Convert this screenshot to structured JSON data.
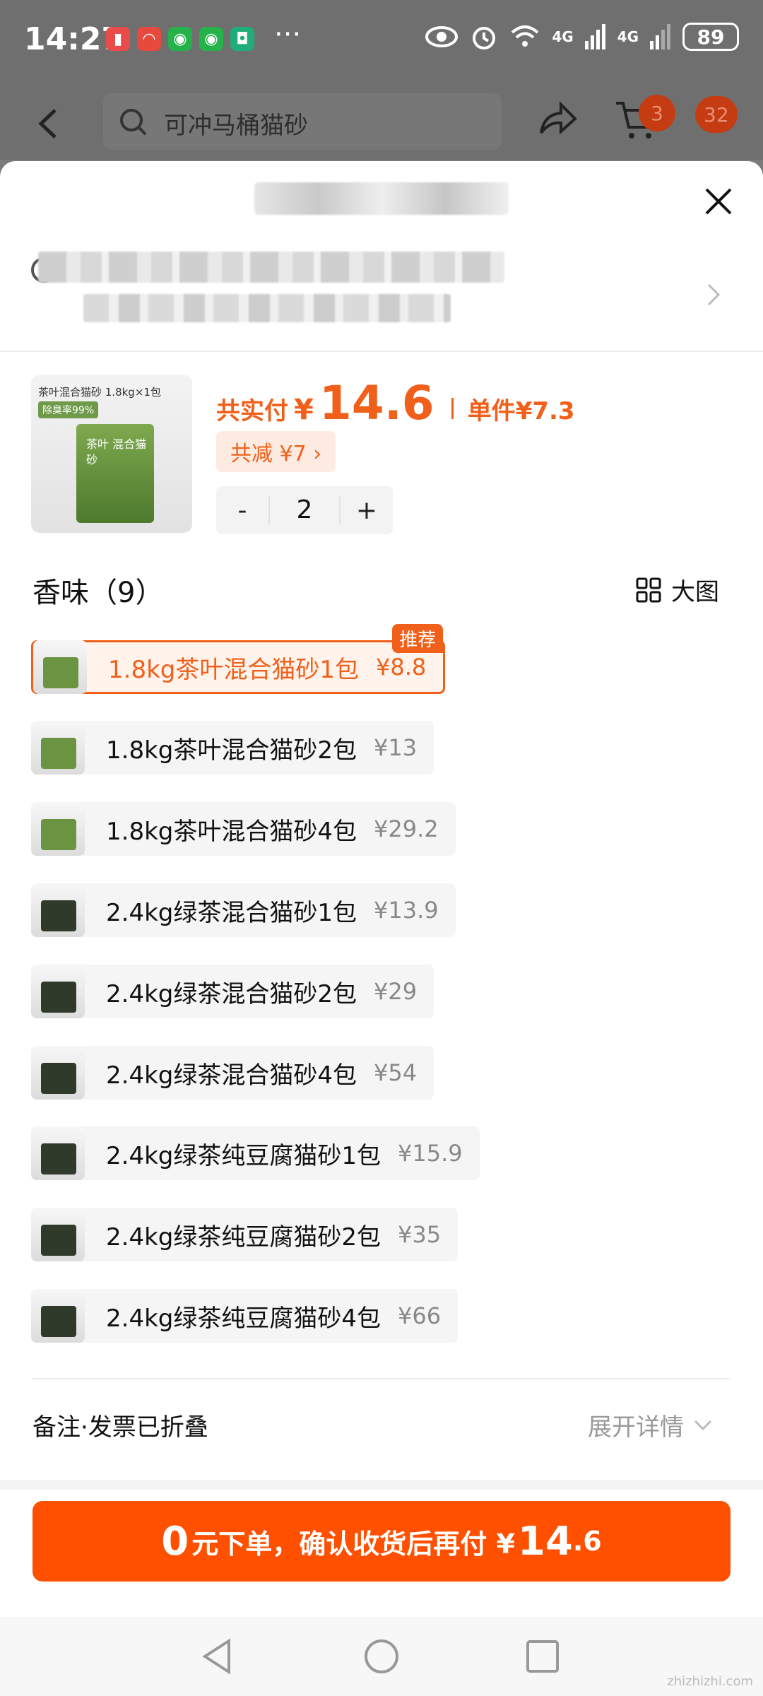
{
  "status_bar": {
    "time": "14:27",
    "battery": "89",
    "network_1": "4G",
    "network_2": "4G"
  },
  "top_nav": {
    "search_placeholder": "可冲马桶猫砂",
    "cart_badge": "3",
    "more_badge": "32"
  },
  "product": {
    "thumb_caption": "茶叶混合猫砂 1.8kg×1包",
    "thumb_tag": "除臭率99%",
    "thumb_bag_text": "茶叶 混合猫砂",
    "pay_label": "共实付",
    "currency": "¥",
    "pay_amount": "14.6",
    "unit_label": "单件",
    "unit_price": "¥7.3",
    "discount_text": "共减 ¥7 ›",
    "quantity": "2",
    "minus": "-",
    "plus": "+"
  },
  "options_section": {
    "title": "香味（9）",
    "big_pic_label": "大图",
    "recommend_tag": "推荐",
    "items": [
      {
        "name": "1.8kg茶叶混合猫砂1包",
        "price": "¥8.8"
      },
      {
        "name": "1.8kg茶叶混合猫砂2包",
        "price": "¥13"
      },
      {
        "name": "1.8kg茶叶混合猫砂4包",
        "price": "¥29.2"
      },
      {
        "name": "2.4kg绿茶混合猫砂1包",
        "price": "¥13.9"
      },
      {
        "name": "2.4kg绿茶混合猫砂2包",
        "price": "¥29"
      },
      {
        "name": "2.4kg绿茶混合猫砂4包",
        "price": "¥54"
      },
      {
        "name": "2.4kg绿茶纯豆腐猫砂1包",
        "price": "¥15.9"
      },
      {
        "name": "2.4kg绿茶纯豆腐猫砂2包",
        "price": "¥35"
      },
      {
        "name": "2.4kg绿茶纯豆腐猫砂4包",
        "price": "¥66"
      }
    ]
  },
  "remarks": {
    "label": "备注·发票已折叠",
    "expand_label": "展开详情"
  },
  "cta": {
    "part_a": "0",
    "part_b": "元下单，确认收货后再付 ¥",
    "part_c": "14",
    "part_d": ".6"
  },
  "watermark": "zhizhizhi.com",
  "colors": {
    "accent": "#ff5000",
    "price_orange": "#f0601a"
  }
}
